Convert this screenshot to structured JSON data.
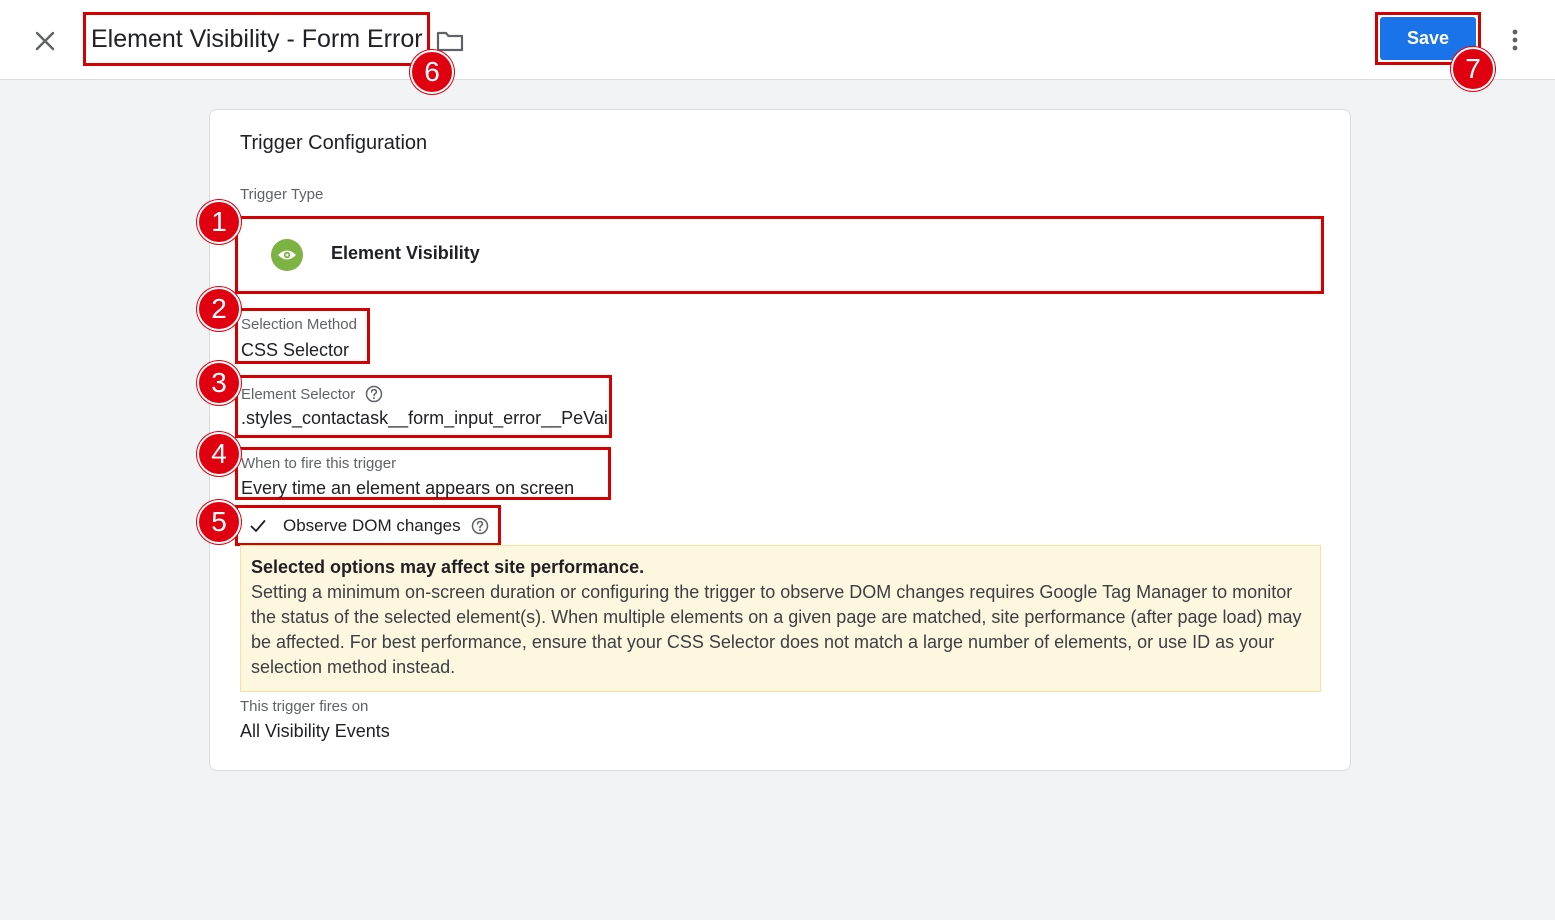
{
  "header": {
    "title": "Element Visibility - Form Error",
    "save_label": "Save"
  },
  "card": {
    "title": "Trigger Configuration",
    "trigger_type_label": "Trigger Type",
    "trigger_type_value": "Element Visibility",
    "selection_method_label": "Selection Method",
    "selection_method_value": "CSS Selector",
    "element_selector_label": "Element Selector",
    "element_selector_value": ".styles_contactask__form_input_error__PeVai",
    "when_to_fire_label": "When to fire this trigger",
    "when_to_fire_value": "Every time an element appears on screen",
    "observe_dom_label": "Observe DOM changes",
    "warning_title": "Selected options may affect site performance.",
    "warning_body": "Setting a minimum on-screen duration or configuring the trigger to observe DOM changes requires Google Tag Manager to monitor the status of the selected element(s). When multiple elements on a given page are matched, site performance (after page load) may be affected. For best performance, ensure that your CSS Selector does not match a large number of elements, or use ID as your selection method instead.",
    "fires_on_label": "This trigger fires on",
    "fires_on_value": "All Visibility Events"
  },
  "badges": [
    "1",
    "2",
    "3",
    "4",
    "5",
    "6",
    "7"
  ],
  "icons": {
    "close": "close-icon",
    "folder": "folder-icon",
    "more": "more-vert-icon",
    "eye": "eye-icon",
    "help": "help-circle-icon",
    "check": "check-icon"
  },
  "colors": {
    "accent": "#1a73e8",
    "highlight": "#d50000",
    "badge": "#e1000f",
    "trigger_icon": "#7cb342",
    "warning_bg": "#fef7e0"
  }
}
